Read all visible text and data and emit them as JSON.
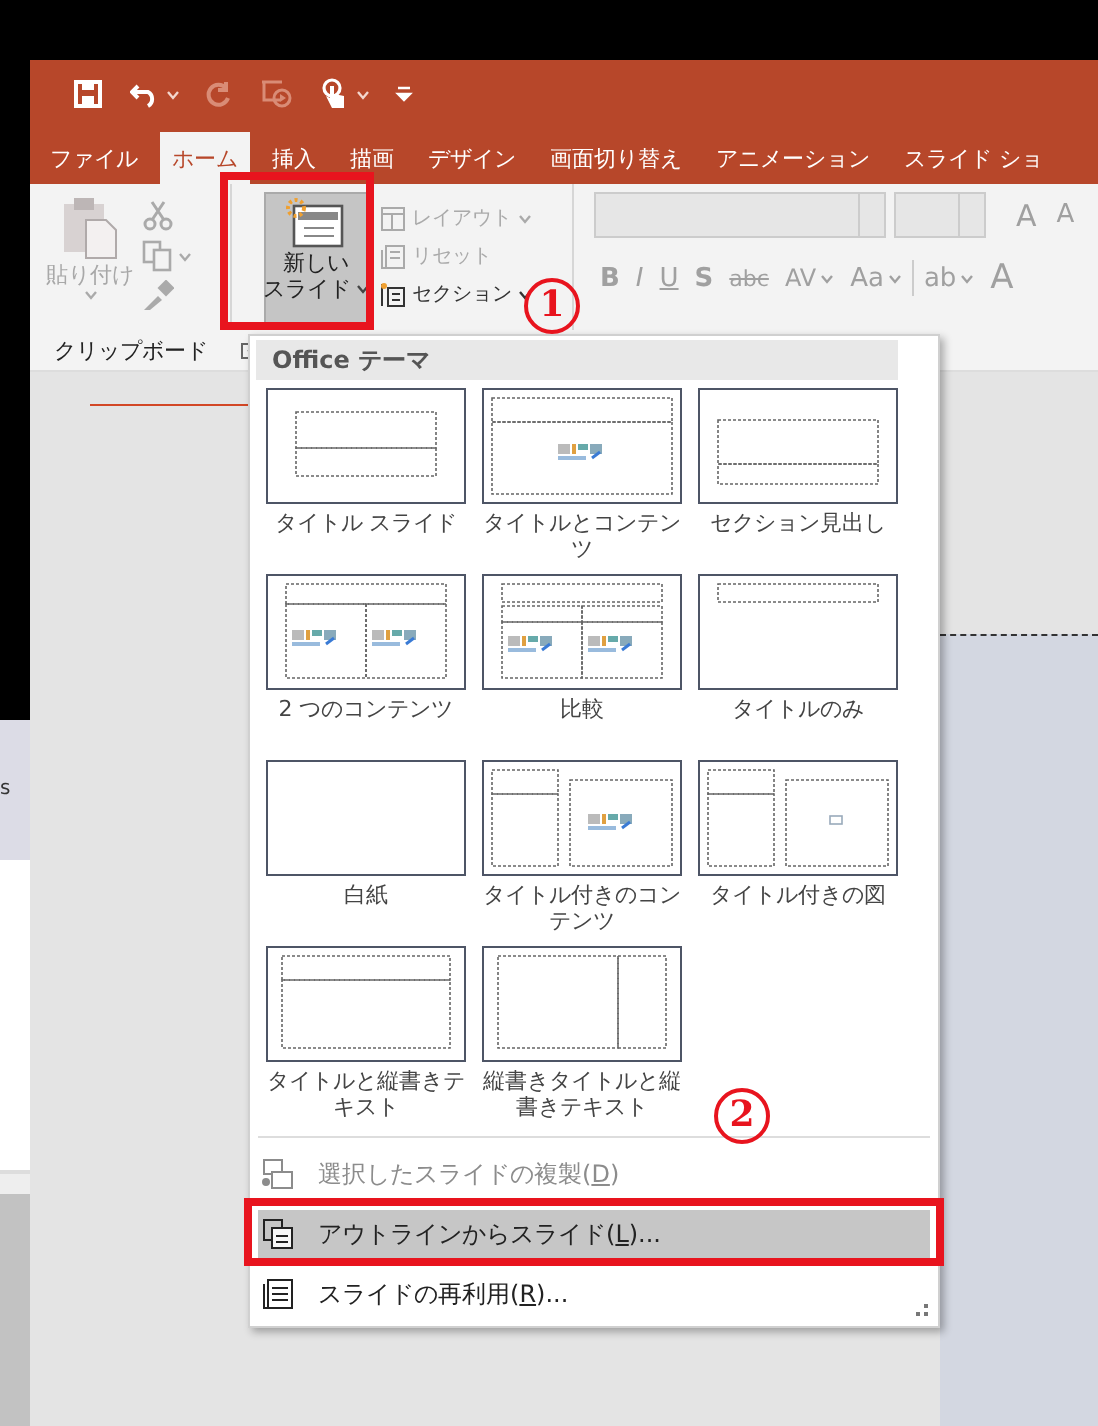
{
  "quick_access": [
    {
      "kind": "save",
      "disabled": false,
      "has_menu": false
    },
    {
      "kind": "undo",
      "disabled": false,
      "has_menu": true
    },
    {
      "kind": "redo",
      "disabled": true,
      "has_menu": false
    },
    {
      "kind": "present",
      "disabled": true,
      "has_menu": false
    },
    {
      "kind": "touch",
      "disabled": false,
      "has_menu": true
    },
    {
      "kind": "customize",
      "disabled": false,
      "has_menu": false
    }
  ],
  "tabs": [
    {
      "label": "ファイル",
      "selected": false
    },
    {
      "label": "ホーム",
      "selected": true
    },
    {
      "label": "挿入",
      "selected": false
    },
    {
      "label": "描画",
      "selected": false
    },
    {
      "label": "デザイン",
      "selected": false
    },
    {
      "label": "画面切り替え",
      "selected": false
    },
    {
      "label": "アニメーション",
      "selected": false
    },
    {
      "label": "スライド ショ",
      "selected": false
    }
  ],
  "ribbon": {
    "clipboard": {
      "paste": {
        "label": "貼り付け",
        "disabled": true
      },
      "tools": [
        {
          "kind": "cut",
          "disabled": true,
          "has_menu": false
        },
        {
          "kind": "copy",
          "disabled": true,
          "has_menu": true
        },
        {
          "kind": "painter",
          "disabled": true,
          "has_menu": false
        }
      ],
      "group_label": "クリップボード"
    },
    "slides": {
      "new_slide": {
        "line1": "新しい",
        "line2": "スライド",
        "pressed": true
      },
      "commands": [
        {
          "kind": "layout",
          "label": "レイアウト",
          "disabled": true,
          "has_menu": true
        },
        {
          "kind": "reset",
          "label": "リセット",
          "disabled": true,
          "has_menu": false
        },
        {
          "kind": "section",
          "label": "セクション",
          "disabled": false,
          "has_menu": true
        }
      ]
    },
    "font": {
      "disabled": true,
      "size_buttons": [
        {
          "kind": "grow",
          "text": "A"
        },
        {
          "kind": "shrink",
          "text": "A"
        }
      ],
      "format_buttons": [
        {
          "kind": "bold",
          "text": "B",
          "has_menu": false
        },
        {
          "kind": "italic",
          "text": "I",
          "has_menu": false
        },
        {
          "kind": "underline",
          "text": "U",
          "has_menu": false
        },
        {
          "kind": "shadow",
          "text": "S",
          "has_menu": false
        },
        {
          "kind": "strike",
          "text": "abc",
          "has_menu": false
        },
        {
          "kind": "spacing",
          "text": "AV",
          "has_menu": true
        },
        {
          "kind": "case",
          "text": "Aa",
          "has_menu": true
        }
      ],
      "color_buttons": [
        {
          "kind": "highlight",
          "text": "ab",
          "has_menu": true
        },
        {
          "kind": "color",
          "text": "A",
          "has_menu": false
        }
      ]
    }
  },
  "left_pane": {
    "text": "s"
  },
  "menu": {
    "header": "Office テーマ",
    "layouts": [
      {
        "kind": "title",
        "label": "タイトル スライド"
      },
      {
        "kind": "title_content",
        "label": "タイトルとコンテンツ"
      },
      {
        "kind": "section",
        "label": "セクション見出し"
      },
      {
        "kind": "two_content",
        "label": "2 つのコンテンツ"
      },
      {
        "kind": "comparison",
        "label": "比較"
      },
      {
        "kind": "title_only",
        "label": "タイトルのみ"
      },
      {
        "kind": "blank",
        "label": "白紙"
      },
      {
        "kind": "content_caption",
        "label": "タイトル付きのコンテンツ"
      },
      {
        "kind": "picture_caption",
        "label": "タイトル付きの図"
      },
      {
        "kind": "vertical_text",
        "label": "タイトルと縦書きテキスト"
      },
      {
        "kind": "vertical_title",
        "label": "縦書きタイトルと縦書きテキスト"
      }
    ],
    "items": [
      {
        "kind": "duplicate",
        "label_start": "選択したスライドの複製(",
        "access_key": "D",
        "label_end": ")",
        "disabled": true,
        "selected": false
      },
      {
        "kind": "outline",
        "label_start": "アウトラインからスライド(",
        "access_key": "L",
        "label_end": ")...",
        "disabled": false,
        "selected": true
      },
      {
        "kind": "reuse",
        "label_start": "スライドの再利用(",
        "access_key": "R",
        "label_end": ")...",
        "disabled": false,
        "selected": false
      }
    ]
  },
  "annotations": [
    {
      "kind": "box"
    },
    {
      "kind": "number",
      "text": "1"
    },
    {
      "kind": "number",
      "text": "2"
    },
    {
      "kind": "box"
    }
  ]
}
